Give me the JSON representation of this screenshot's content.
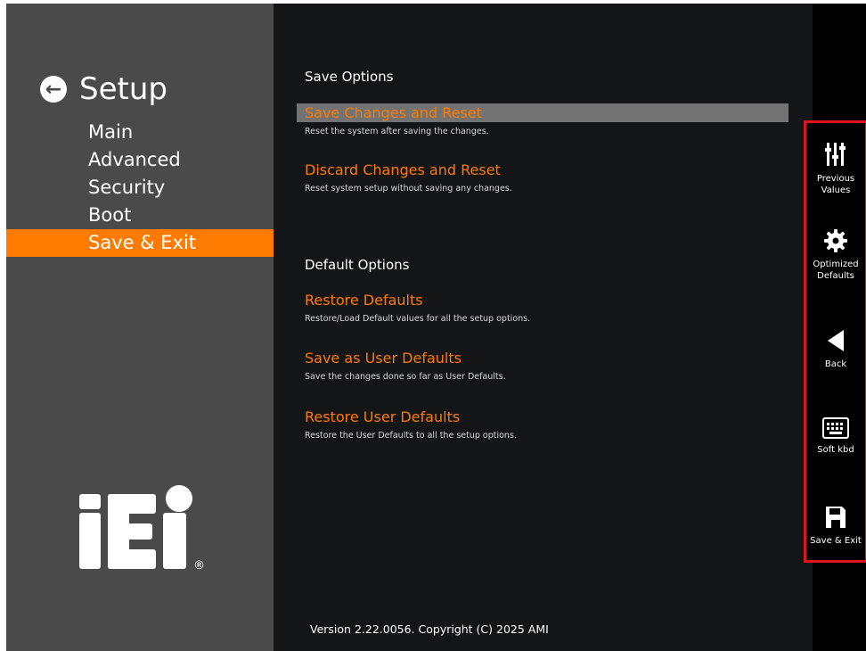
{
  "sidebar": {
    "title": "Setup",
    "items": [
      {
        "label": "Main"
      },
      {
        "label": "Advanced"
      },
      {
        "label": "Security"
      },
      {
        "label": "Boot"
      },
      {
        "label": "Save & Exit"
      }
    ],
    "logo_text": "iEi",
    "logo_mark": "®"
  },
  "main": {
    "save_section": "Save Options",
    "save_options": [
      {
        "label": "Save Changes and Reset",
        "desc": "Reset the system after saving the changes."
      },
      {
        "label": "Discard Changes and Reset",
        "desc": "Reset system setup without saving any changes."
      }
    ],
    "default_section": "Default Options",
    "default_options": [
      {
        "label": "Restore Defaults",
        "desc": "Restore/Load Default values for all the setup options."
      },
      {
        "label": "Save as User Defaults",
        "desc": "Save the changes done so far as User Defaults."
      },
      {
        "label": "Restore User Defaults",
        "desc": "Restore the User Defaults to all the setup options."
      }
    ],
    "version": "Version 2.22.0056. Copyright (C) 2025 AMI"
  },
  "right_panel": {
    "buttons": [
      {
        "label_line1": "Previous",
        "label_line2": "Values",
        "icon": "sliders-icon"
      },
      {
        "label_line1": "Optimized",
        "label_line2": "Defaults",
        "icon": "gear-icon"
      },
      {
        "label_line1": "Back",
        "label_line2": "",
        "icon": "back-triangle-icon"
      },
      {
        "label_line1": "Soft kbd",
        "label_line2": "",
        "icon": "keyboard-icon"
      },
      {
        "label_line1": "Save & Exit",
        "label_line2": "",
        "icon": "floppy-icon"
      }
    ]
  },
  "colors": {
    "accent": "#ff7b00",
    "sidebar_bg": "#4a4a4a",
    "main_bg": "#141517",
    "highlight_bg": "#737373",
    "panel_border": "#e0141e"
  }
}
